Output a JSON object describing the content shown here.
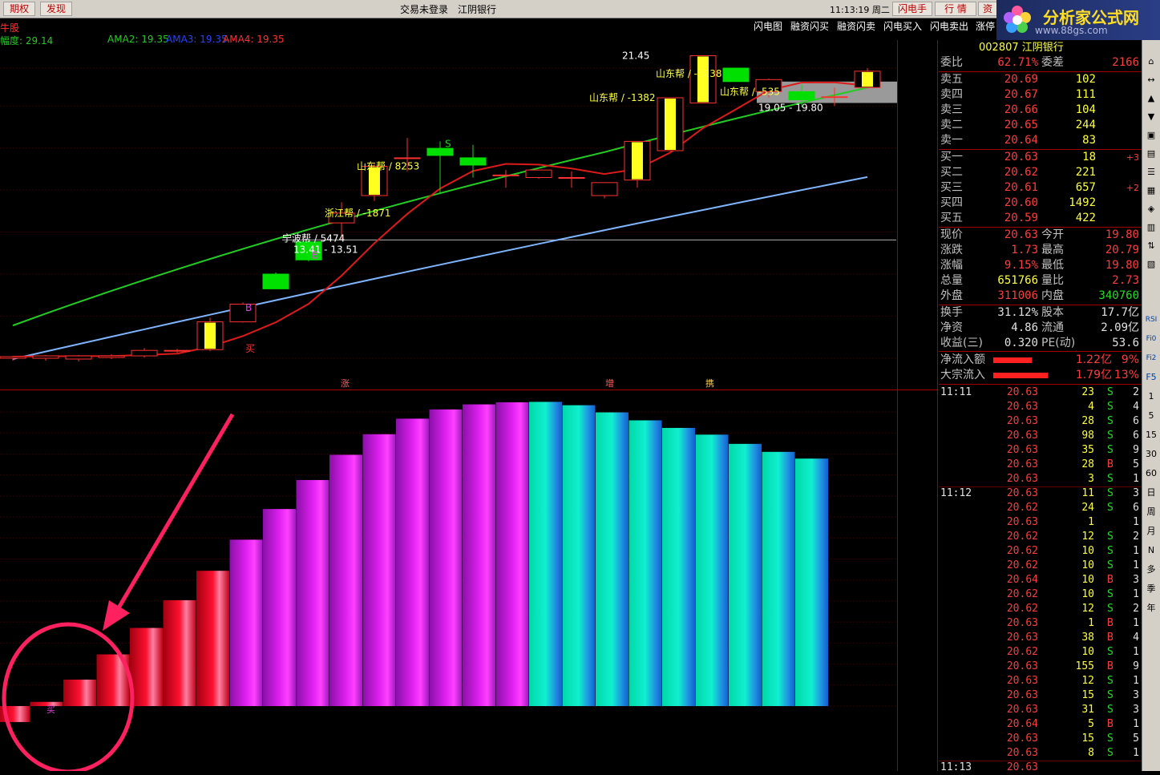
{
  "topbar": {
    "btn_options": "期权",
    "btn_discover": "发现",
    "login_status": "交易未登录",
    "stock_name": "江阴银行",
    "clock": "11:13:19 周二",
    "btn_flash": "闪电手",
    "btn_quote": "行 情",
    "btn_capital": "资"
  },
  "logo": {
    "title": "分析家公式网",
    "url": "www.88gs.com"
  },
  "subtabs": [
    "闪电图",
    "融资闪买",
    "融资闪卖",
    "闪电买入",
    "闪电卖出",
    "涨停"
  ],
  "indicator": {
    "name_fragment": "牛股",
    "amp": "幅度: 29.14",
    "ama2": "AMA2: 19.35",
    "ama3": "AMA3: 19.35",
    "ama4": "AMA4: 19.35",
    "colors": {
      "ama2": "#22cc22",
      "ama3": "#2244ff",
      "ama4": "#ff3030"
    }
  },
  "chart_data": [
    {
      "type": "candlestick",
      "y_ticks": [
        "20.79",
        "18.90",
        "17.01",
        "15.31",
        "13.78",
        "12.40",
        "11.16",
        "10.04"
      ],
      "candles": [
        {
          "o": 10.04,
          "h": 10.1,
          "l": 9.98,
          "c": 10.08
        },
        {
          "o": 10.04,
          "h": 10.12,
          "l": 9.98,
          "c": 10.1
        },
        {
          "o": 10.02,
          "h": 10.12,
          "l": 9.96,
          "c": 10.1
        },
        {
          "o": 10.06,
          "h": 10.14,
          "l": 10.02,
          "c": 10.1
        },
        {
          "o": 10.1,
          "h": 10.3,
          "l": 10.06,
          "c": 10.24
        },
        {
          "o": 10.22,
          "h": 10.28,
          "l": 10.18,
          "c": 10.24
        },
        {
          "o": 10.26,
          "h": 11.12,
          "l": 10.22,
          "c": 11.0
        },
        {
          "o": 11.0,
          "h": 11.55,
          "l": 10.98,
          "c": 11.5
        },
        {
          "o": 12.4,
          "h": 12.45,
          "l": 11.95,
          "c": 11.95
        },
        {
          "o": 13.45,
          "h": 13.51,
          "l": 12.8,
          "c": 12.85
        },
        {
          "o": 14.1,
          "h": 14.85,
          "l": 13.55,
          "c": 14.45
        },
        {
          "o": 15.1,
          "h": 16.35,
          "l": 14.9,
          "c": 16.25
        },
        {
          "o": 16.6,
          "h": 17.45,
          "l": 16.05,
          "c": 16.6
        },
        {
          "o": 17.0,
          "h": 17.3,
          "l": 15.2,
          "c": 16.7
        },
        {
          "o": 16.6,
          "h": 17.15,
          "l": 15.8,
          "c": 16.3
        },
        {
          "o": 15.9,
          "h": 16.1,
          "l": 15.4,
          "c": 15.9
        },
        {
          "o": 15.8,
          "h": 16.0,
          "l": 15.75,
          "c": 16.1
        },
        {
          "o": 15.8,
          "h": 16.05,
          "l": 15.4,
          "c": 15.8
        },
        {
          "o": 15.1,
          "h": 15.3,
          "l": 15.0,
          "c": 15.6
        },
        {
          "o": 15.7,
          "h": 17.3,
          "l": 15.4,
          "c": 17.3
        },
        {
          "o": 16.9,
          "h": 19.3,
          "l": 16.9,
          "c": 19.3
        },
        {
          "o": 19.05,
          "h": 21.45,
          "l": 19.05,
          "c": 21.45
        },
        {
          "o": 20.79,
          "h": 20.79,
          "l": 20.1,
          "c": 20.1
        },
        {
          "o": 19.6,
          "h": 20.25,
          "l": 19.3,
          "c": 20.2
        },
        {
          "o": 19.6,
          "h": 19.95,
          "l": 18.85,
          "c": 19.2
        },
        {
          "o": 19.35,
          "h": 19.8,
          "l": 18.9,
          "c": 19.35
        },
        {
          "o": 19.8,
          "h": 20.79,
          "l": 19.8,
          "c": 20.63
        }
      ],
      "annotations": [
        "宁波帮 / 5474",
        "13.41 - 13.51",
        "浙江帮 / -1871",
        "山东帮 / 8253",
        "山东帮 / -1382",
        "21.45",
        "山东帮 / -3238",
        "山东帮 / -535",
        "19.05 - 19.80",
        "B",
        "B",
        "买",
        "S"
      ],
      "bottom_labels": [
        "涨",
        "增",
        "携"
      ]
    },
    {
      "type": "bar",
      "y_ticks": [
        "70.00",
        "65.00",
        "60.00",
        "55.00",
        "50.00",
        "45.00",
        "40.00",
        "35.00",
        "30.00",
        "25.00",
        "20.00",
        "15.00",
        "10.00",
        "5.00",
        "0.00"
      ],
      "ylim": [
        0,
        70
      ],
      "values": [
        -3.8,
        1.0,
        6.3,
        12.3,
        18.6,
        25.2,
        32.2,
        39.6,
        46.9,
        53.8,
        59.8,
        64.7,
        68.4,
        70.6,
        71.8,
        72.3,
        72.4,
        71.6,
        69.9,
        68.0,
        66.2,
        64.6,
        62.4,
        60.5,
        58.9
      ],
      "marker_label": "买"
    }
  ],
  "orderbook": {
    "weibi": {
      "label": "委比",
      "value": "62.71%",
      "label2": "委差",
      "value2": "2166"
    },
    "code_title": "002807 江阴银行",
    "asks": [
      {
        "label": "卖五",
        "price": "20.69",
        "vol": "102"
      },
      {
        "label": "卖四",
        "price": "20.67",
        "vol": "111"
      },
      {
        "label": "卖三",
        "price": "20.66",
        "vol": "104"
      },
      {
        "label": "卖二",
        "price": "20.65",
        "vol": "244"
      },
      {
        "label": "卖一",
        "price": "20.64",
        "vol": "83"
      }
    ],
    "bids": [
      {
        "label": "买一",
        "price": "20.63",
        "vol": "18",
        "chg": "+3"
      },
      {
        "label": "买二",
        "price": "20.62",
        "vol": "221",
        "chg": ""
      },
      {
        "label": "买三",
        "price": "20.61",
        "vol": "657",
        "chg": "+2"
      },
      {
        "label": "买四",
        "price": "20.60",
        "vol": "1492",
        "chg": ""
      },
      {
        "label": "买五",
        "price": "20.59",
        "vol": "422",
        "chg": ""
      }
    ]
  },
  "quote": [
    {
      "l1": "现价",
      "v1": "20.63",
      "l2": "今开",
      "v2": "19.80"
    },
    {
      "l1": "涨跌",
      "v1": "1.73",
      "l2": "最高",
      "v2": "20.79"
    },
    {
      "l1": "涨幅",
      "v1": "9.15%",
      "l2": "最低",
      "v2": "19.80"
    },
    {
      "l1": "总量",
      "v1": "651766",
      "l2": "量比",
      "v2": "2.73"
    },
    {
      "l1": "外盘",
      "v1": "311006",
      "l2": "内盘",
      "v2": "340760"
    }
  ],
  "fundamentals": [
    {
      "l1": "换手",
      "v1": "31.12%",
      "l2": "股本",
      "v2": "17.7亿"
    },
    {
      "l1": "净资",
      "v1": "4.86",
      "l2": "流通",
      "v2": "2.09亿"
    },
    {
      "l1": "收益(三)",
      "v1": "0.320",
      "l2": "PE(动)",
      "v2": "53.6"
    }
  ],
  "flows": [
    {
      "label": "净流入额",
      "value": "1.22亿",
      "pct": "9%",
      "bar": 0.28
    },
    {
      "label": "大宗流入",
      "value": "1.79亿",
      "pct": "13%",
      "bar": 0.4
    }
  ],
  "ticks": [
    {
      "time": "11:11",
      "price": "20.63",
      "vol": "23",
      "side": "S",
      "n": "2"
    },
    {
      "time": "",
      "price": "20.63",
      "vol": "4",
      "side": "S",
      "n": "4"
    },
    {
      "time": "",
      "price": "20.63",
      "vol": "28",
      "side": "S",
      "n": "6"
    },
    {
      "time": "",
      "price": "20.63",
      "vol": "98",
      "side": "S",
      "n": "6"
    },
    {
      "time": "",
      "price": "20.63",
      "vol": "35",
      "side": "S",
      "n": "9"
    },
    {
      "time": "",
      "price": "20.63",
      "vol": "28",
      "side": "B",
      "n": "5"
    },
    {
      "time": "",
      "price": "20.63",
      "vol": "3",
      "side": "S",
      "n": "1"
    },
    {
      "time": "11:12",
      "price": "20.63",
      "vol": "11",
      "side": "S",
      "n": "3"
    },
    {
      "time": "",
      "price": "20.62",
      "vol": "24",
      "side": "S",
      "n": "6"
    },
    {
      "time": "",
      "price": "20.63",
      "vol": "1",
      "side": "",
      "n": "1"
    },
    {
      "time": "",
      "price": "20.62",
      "vol": "12",
      "side": "S",
      "n": "2"
    },
    {
      "time": "",
      "price": "20.62",
      "vol": "10",
      "side": "S",
      "n": "1"
    },
    {
      "time": "",
      "price": "20.62",
      "vol": "10",
      "side": "S",
      "n": "1"
    },
    {
      "time": "",
      "price": "20.64",
      "vol": "10",
      "side": "B",
      "n": "3"
    },
    {
      "time": "",
      "price": "20.62",
      "vol": "10",
      "side": "S",
      "n": "1"
    },
    {
      "time": "",
      "price": "20.62",
      "vol": "12",
      "side": "S",
      "n": "2"
    },
    {
      "time": "",
      "price": "20.63",
      "vol": "1",
      "side": "B",
      "n": "1"
    },
    {
      "time": "",
      "price": "20.63",
      "vol": "38",
      "side": "B",
      "n": "4"
    },
    {
      "time": "",
      "price": "20.62",
      "vol": "10",
      "side": "S",
      "n": "1"
    },
    {
      "time": "",
      "price": "20.63",
      "vol": "155",
      "side": "B",
      "n": "9"
    },
    {
      "time": "",
      "price": "20.63",
      "vol": "12",
      "side": "S",
      "n": "1"
    },
    {
      "time": "",
      "price": "20.63",
      "vol": "15",
      "side": "S",
      "n": "3"
    },
    {
      "time": "",
      "price": "20.63",
      "vol": "31",
      "side": "S",
      "n": "3"
    },
    {
      "time": "",
      "price": "20.64",
      "vol": "5",
      "side": "B",
      "n": "1"
    },
    {
      "time": "",
      "price": "20.63",
      "vol": "15",
      "side": "S",
      "n": "5"
    },
    {
      "time": "",
      "price": "20.63",
      "vol": "8",
      "side": "S",
      "n": "1"
    },
    {
      "time": "11:13",
      "price": "20.63",
      "vol": "",
      "side": "",
      "n": ""
    }
  ],
  "toolbar_labels": [
    "RSI",
    "Fi0",
    "Fi2",
    "F5",
    "1",
    "5",
    "15",
    "30",
    "60",
    "日",
    "周",
    "月",
    "N",
    "多",
    "季",
    "年"
  ]
}
